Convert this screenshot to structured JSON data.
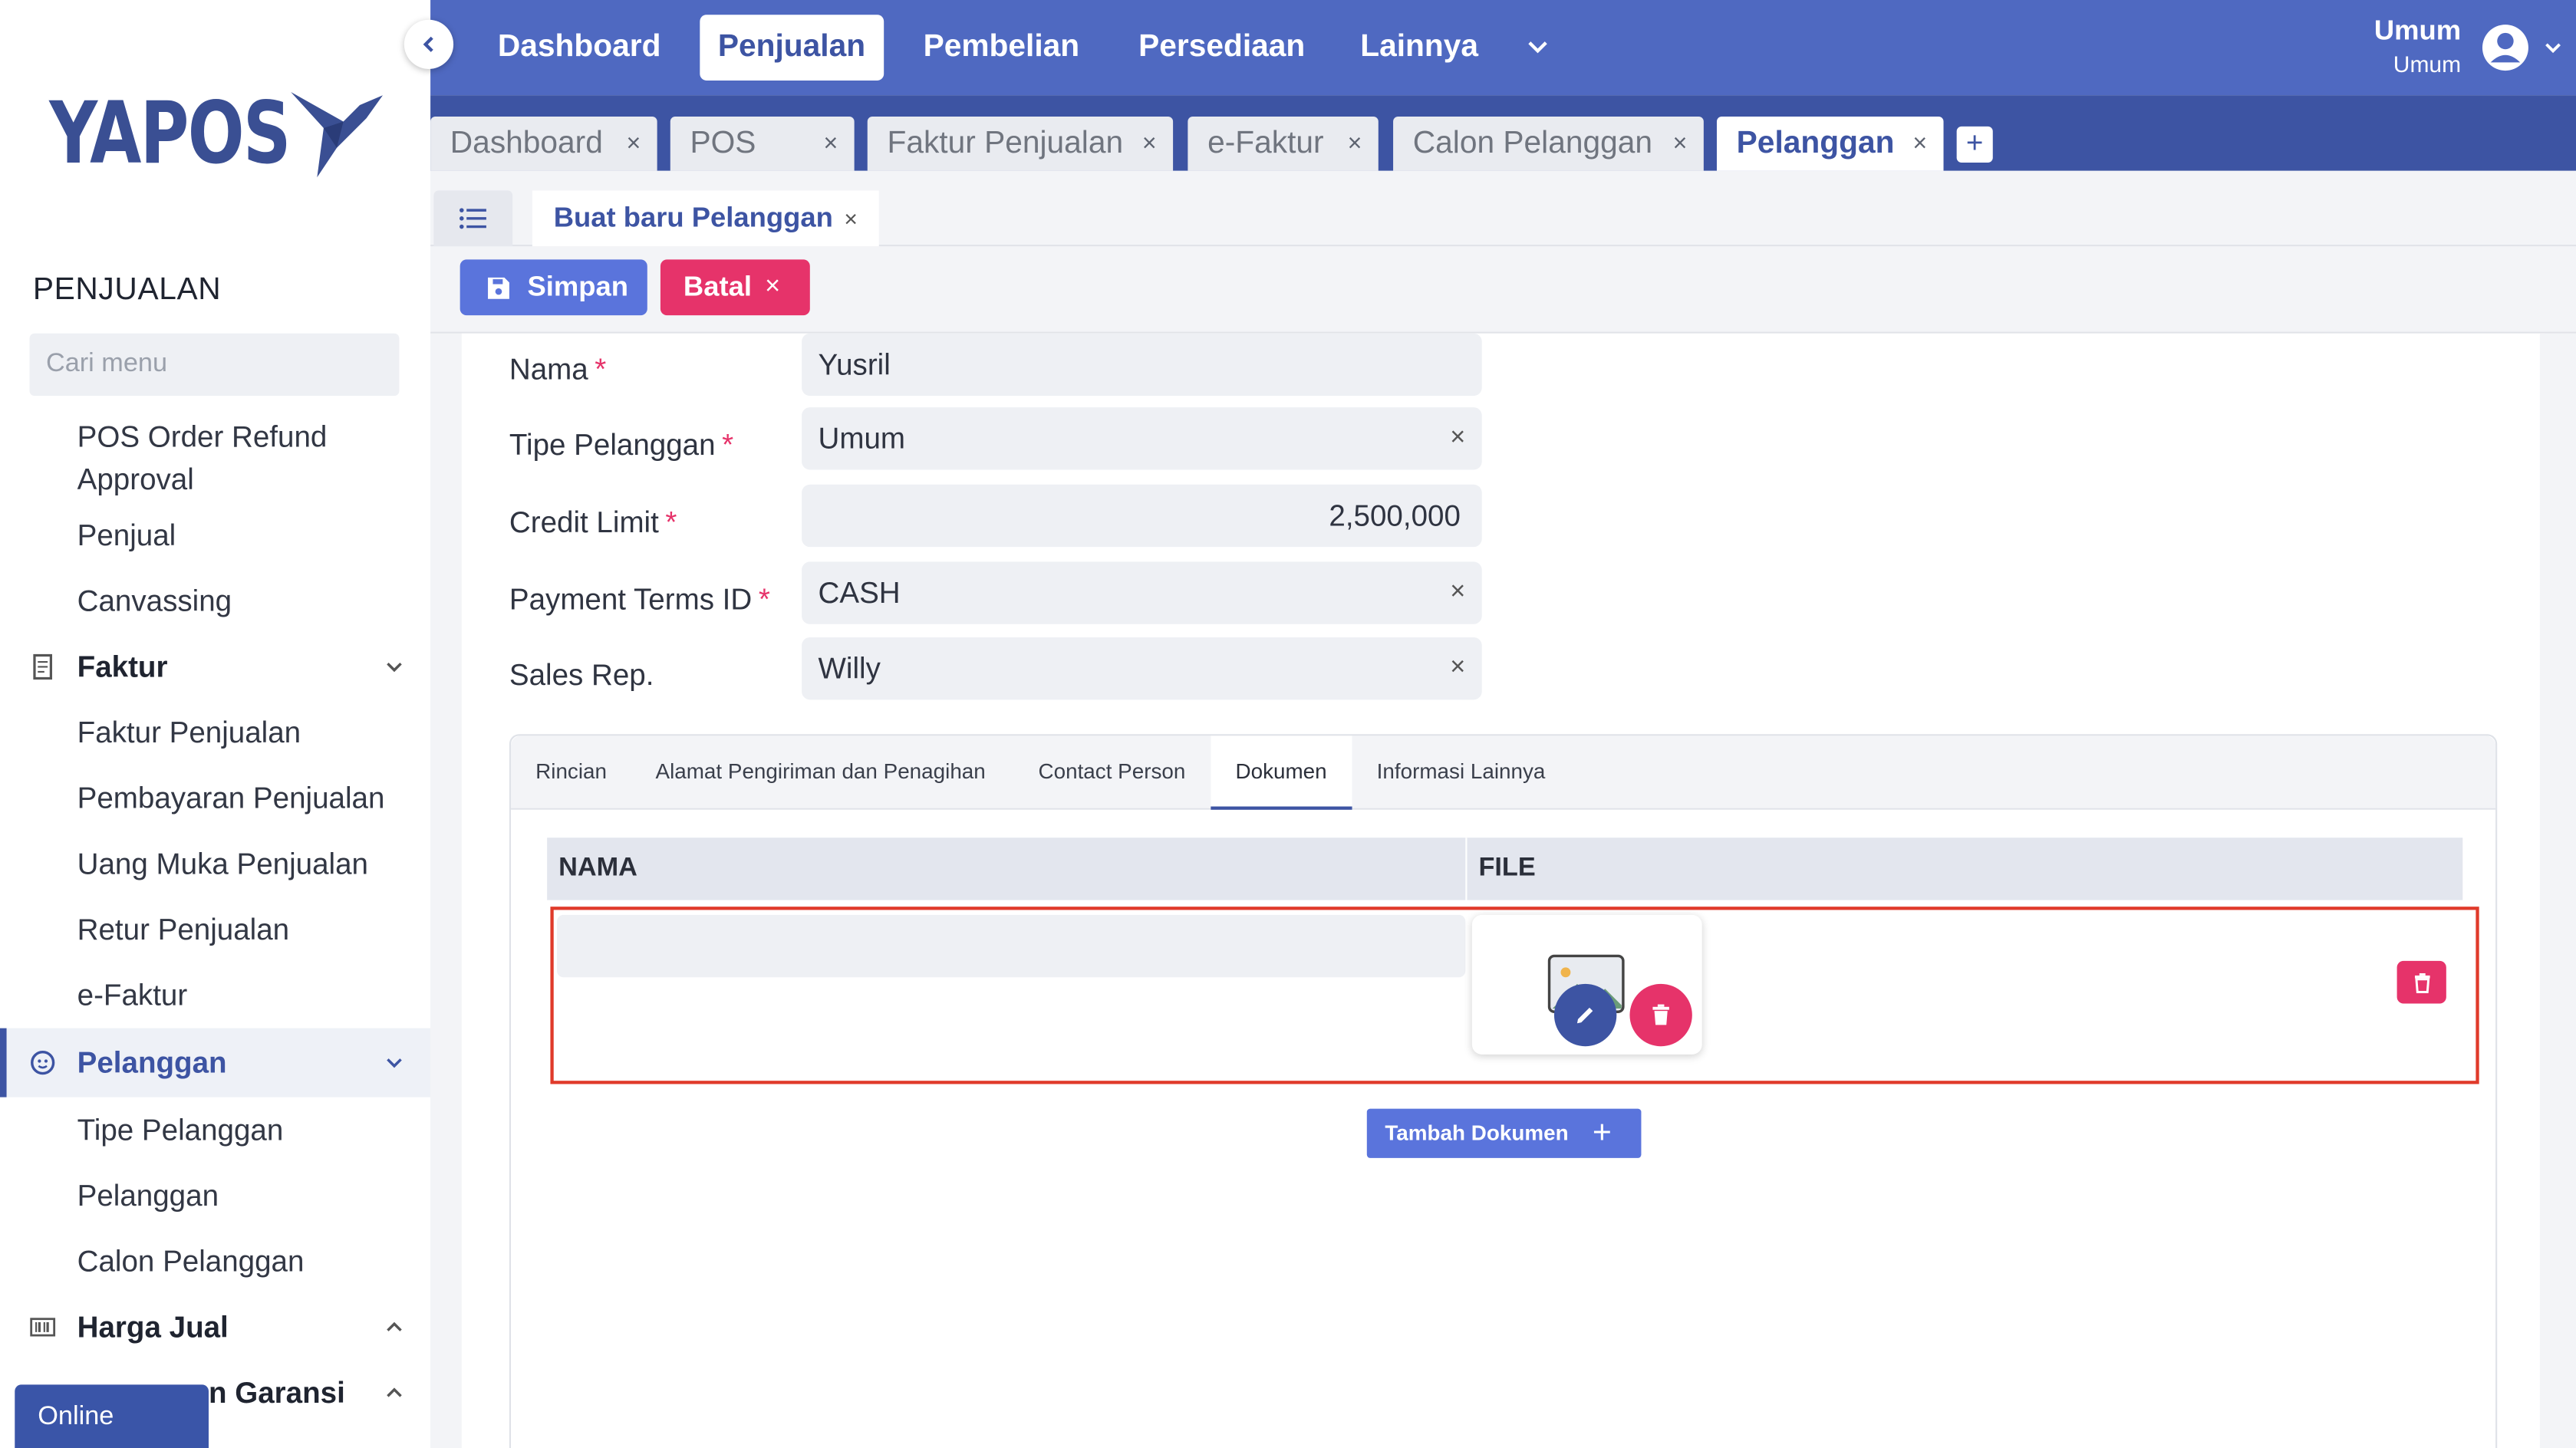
{
  "app": {
    "logo_text": "YAPOS",
    "brand_color": "#3d54a3",
    "accent_color": "#5a74dc",
    "danger_color": "#e6336a"
  },
  "sidebar": {
    "section_title": "PENJUALAN",
    "search_placeholder": "Cari menu",
    "items": {
      "pos_refund": "POS Order Refund Approval",
      "penjual": "Penjual",
      "canvassing": "Canvassing",
      "faktur_group": "Faktur",
      "faktur_penjualan": "Faktur Penjualan",
      "pembayaran_penjualan": "Pembayaran Penjualan",
      "uang_muka": "Uang Muka Penjualan",
      "retur_penjualan": "Retur Penjualan",
      "efaktur": "e-Faktur",
      "pelanggan_group": "Pelanggan",
      "tipe_pelanggan": "Tipe Pelanggan",
      "pelanggan": "Pelanggan",
      "calon_pelanggan": "Calon Pelanggan",
      "harga_jual_group": "Harga Jual",
      "garansi_group": "n Garansi"
    },
    "online_label": "Online"
  },
  "topnav": {
    "items": [
      "Dashboard",
      "Penjualan",
      "Pembelian",
      "Persediaan",
      "Lainnya"
    ],
    "active": "Penjualan",
    "user_name": "Umum",
    "user_sub": "Umum"
  },
  "tabs": {
    "list": [
      "Dashboard",
      "POS",
      "Faktur Penjualan",
      "e-Faktur",
      "Calon Pelanggan",
      "Pelanggan"
    ],
    "active": "Pelanggan",
    "close_symbol": "×",
    "add_symbol": "+"
  },
  "doc_tab": {
    "label": "Buat baru Pelanggan"
  },
  "actions": {
    "save_label": "Simpan",
    "cancel_label": "Batal"
  },
  "form": {
    "nama": {
      "label": "Nama",
      "value": "Yusril"
    },
    "tipe_pelanggan": {
      "label": "Tipe Pelanggan",
      "value": "Umum"
    },
    "credit_limit": {
      "label": "Credit Limit",
      "value": "2,500,000"
    },
    "payment_terms": {
      "label": "Payment Terms ID",
      "value": "CASH"
    },
    "sales_rep": {
      "label": "Sales Rep.",
      "value": "Willy"
    },
    "required_mark": "*",
    "clear_symbol": "×"
  },
  "panel_tabs": {
    "list": [
      "Rincian",
      "Alamat Pengiriman dan Penagihan",
      "Contact Person",
      "Dokumen",
      "Informasi Lainnya"
    ],
    "active": "Dokumen"
  },
  "documents": {
    "col_name": "NAMA",
    "col_file": "FILE",
    "rows": [
      {
        "name": ""
      }
    ],
    "add_label": "Tambah Dokumen",
    "add_symbol": "+"
  }
}
